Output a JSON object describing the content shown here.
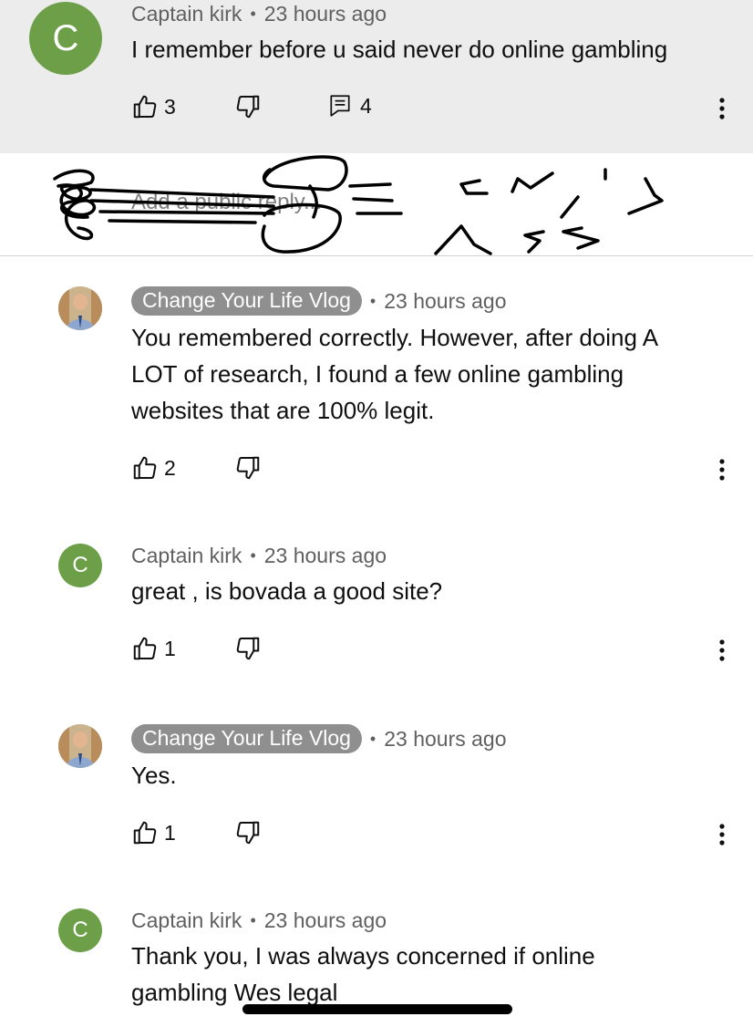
{
  "comment": {
    "avatar_letter": "C",
    "author": "Captain kirk",
    "time": "23 hours ago",
    "text": "I remember before u said never do online gambling",
    "likes": "3",
    "replies": "4"
  },
  "reply_box": {
    "placeholder": "Add a public reply..."
  },
  "replies": [
    {
      "author": "Change Your Life Vlog",
      "time": "23 hours ago",
      "text": "You remembered correctly. However, after doing A LOT of research, I found a few online gambling websites that are 100% legit.",
      "likes": "2"
    },
    {
      "avatar_letter": "C",
      "author": "Captain kirk",
      "time": "23 hours ago",
      "text": "great , is bovada a good site?",
      "likes": "1"
    },
    {
      "author": "Change Your Life Vlog",
      "time": "23 hours ago",
      "text": "Yes.",
      "likes": "1"
    },
    {
      "avatar_letter": "C",
      "author": "Captain kirk",
      "time": "23 hours ago",
      "text": "Thank you, I was always concerned if online gambling Wes legal"
    }
  ],
  "colors": {
    "avatar_green": "#6c9f48",
    "author_badge": "#8f8f8f",
    "top_bg": "#ececec"
  },
  "icons": [
    "thumb-up-icon",
    "thumb-down-icon",
    "reply-icon",
    "more-vert-icon"
  ]
}
